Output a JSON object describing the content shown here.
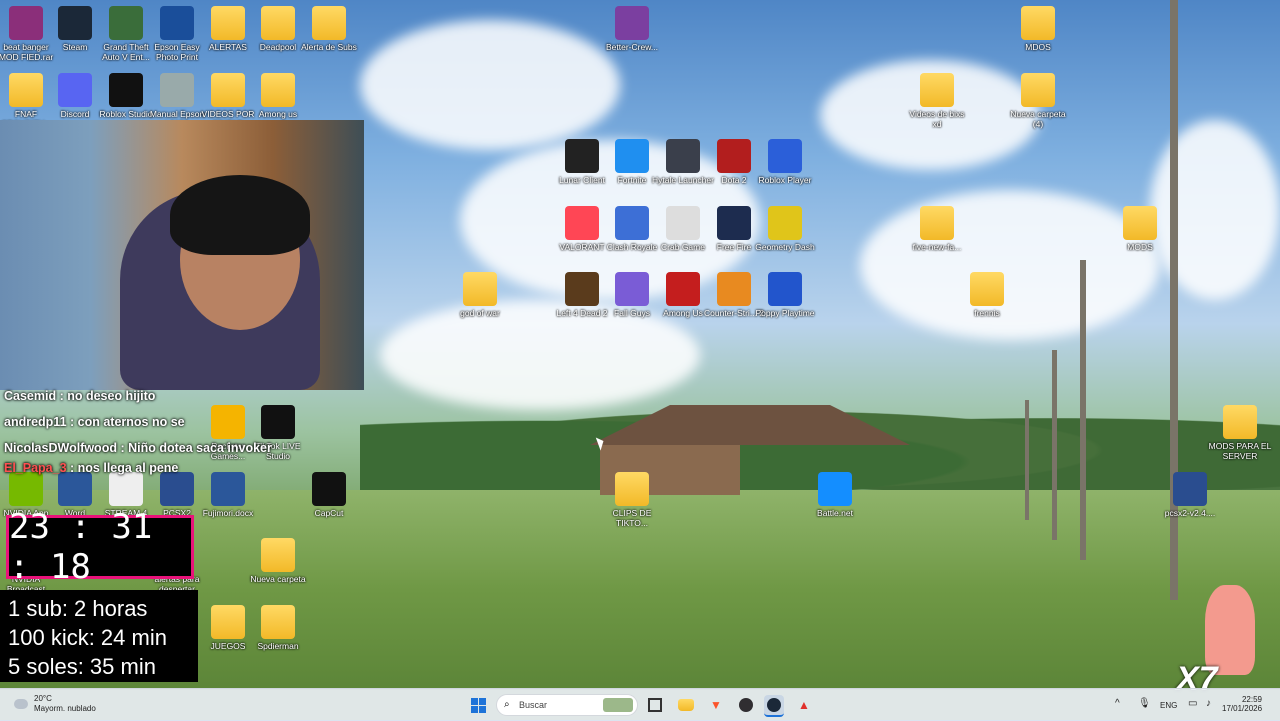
{
  "desktop_icons": [
    {
      "label": "beat banger MOD FIED.rar",
      "icon": "winrar-icon"
    },
    {
      "label": "Steam",
      "icon": "steam-icon"
    },
    {
      "label": "Grand Theft Auto V Ent...",
      "icon": "gta-icon"
    },
    {
      "label": "Epson Easy Photo Print",
      "icon": "epson-icon"
    },
    {
      "label": "ALERTAS",
      "icon": "folder-icon"
    },
    {
      "label": "Deadpool",
      "icon": "folder-icon"
    },
    {
      "label": "Alerta de Subs",
      "icon": "folder-icon"
    },
    {
      "label": "Better-Crew...",
      "icon": "better-crew-icon"
    },
    {
      "label": "MDOS",
      "icon": "folder-icon"
    },
    {
      "label": "FNAF SECURITY...",
      "icon": "folder-icon"
    },
    {
      "label": "Discord",
      "icon": "discord-icon"
    },
    {
      "label": "Roblox Studio",
      "icon": "roblox-studio-icon"
    },
    {
      "label": "Manual Epson L3150",
      "icon": "epson-manual-icon"
    },
    {
      "label": "VIDEOS POR EDITAR",
      "icon": "folder-icon"
    },
    {
      "label": "Among us",
      "icon": "folder-icon"
    },
    {
      "label": "Videos de bixs xd",
      "icon": "folder-icon"
    },
    {
      "label": "Nueva carpeta (4)",
      "icon": "folder-icon"
    },
    {
      "label": "Lunar Client",
      "icon": "lunar-client-icon"
    },
    {
      "label": "Fortnite",
      "icon": "fortnite-icon"
    },
    {
      "label": "Hytale Launcher",
      "icon": "hytale-icon"
    },
    {
      "label": "Dota 2",
      "icon": "dota2-icon"
    },
    {
      "label": "Roblox Player",
      "icon": "roblox-player-icon"
    },
    {
      "label": "VALORANT",
      "icon": "valorant-icon"
    },
    {
      "label": "Clash Royale",
      "icon": "clash-royale-icon"
    },
    {
      "label": "Crab Game",
      "icon": "crab-game-icon"
    },
    {
      "label": "Free Fire",
      "icon": "free-fire-icon"
    },
    {
      "label": "Geometry Dash",
      "icon": "geometry-dash-icon"
    },
    {
      "label": "five-new-fa...",
      "icon": "folder-icon"
    },
    {
      "label": "MODS",
      "icon": "folder-icon"
    },
    {
      "label": "god of war",
      "icon": "folder-icon"
    },
    {
      "label": "Left 4 Dead 2",
      "icon": "left4dead-icon"
    },
    {
      "label": "Fall Guys",
      "icon": "fall-guys-icon"
    },
    {
      "label": "Among Us",
      "icon": "among-us-icon"
    },
    {
      "label": "Counter-Stri... 2",
      "icon": "cs2-icon"
    },
    {
      "label": "Poppy Playtime",
      "icon": "poppy-playtime-icon"
    },
    {
      "label": "frennis",
      "icon": "folder-icon"
    },
    {
      "label": "Rockstar Games...",
      "icon": "rockstar-icon"
    },
    {
      "label": "TikTok LIVE Studio",
      "icon": "tiktok-icon"
    },
    {
      "label": "MODS PARA EL SERVER",
      "icon": "folder-icon"
    },
    {
      "label": "NVIDIA App",
      "icon": "nvidia-icon"
    },
    {
      "label": "Word",
      "icon": "word-icon"
    },
    {
      "label": "STREAM 4 FOR...",
      "icon": "file-icon"
    },
    {
      "label": "PCSX2",
      "icon": "pcsx2-icon"
    },
    {
      "label": "Fujimori.docx",
      "icon": "word-doc-icon"
    },
    {
      "label": "CapCut",
      "icon": "capcut-icon"
    },
    {
      "label": "CLIPS DE TIKTO...",
      "icon": "folder-icon"
    },
    {
      "label": "Battle.net",
      "icon": "battlenet-icon"
    },
    {
      "label": "pcsx2-v2.4....",
      "icon": "pcsx2-icon"
    },
    {
      "label": "NVIDIA Broadcast",
      "icon": "nvidia-broadcast-icon"
    },
    {
      "label": "alertas para despertar",
      "icon": "folder-icon"
    },
    {
      "label": "Nueva carpeta",
      "icon": "folder-icon"
    },
    {
      "label": "JUEGOS",
      "icon": "folder-icon"
    },
    {
      "label": "Spdierman",
      "icon": "folder-icon"
    }
  ],
  "chat": [
    {
      "user": "Casemid",
      "text": "no deseo hijito"
    },
    {
      "user": "andredp11",
      "text": "con aternos no se"
    },
    {
      "user": "NicolasDWolfwood",
      "text": "Niño dotea saca invoker"
    },
    {
      "user": "El_Papa_3",
      "text": "nos llega al pene"
    }
  ],
  "timer": {
    "value": "23 : 31 : 18"
  },
  "goals": [
    "1 sub: 2 horas",
    "100 kick: 24 min",
    "5 soles: 35 min"
  ],
  "taskbar": {
    "weather_temp": "20°C",
    "weather_desc": "Mayorm. nublado",
    "search_placeholder": "Buscar",
    "lang": "ENG",
    "time": "22:59",
    "date": "17/01/2026"
  },
  "overlay_badge": "X7",
  "colors": {
    "timer_border": "#e8137a",
    "taskbar_bg": "#e8edf3",
    "chat_user_red": "#ff5050"
  }
}
